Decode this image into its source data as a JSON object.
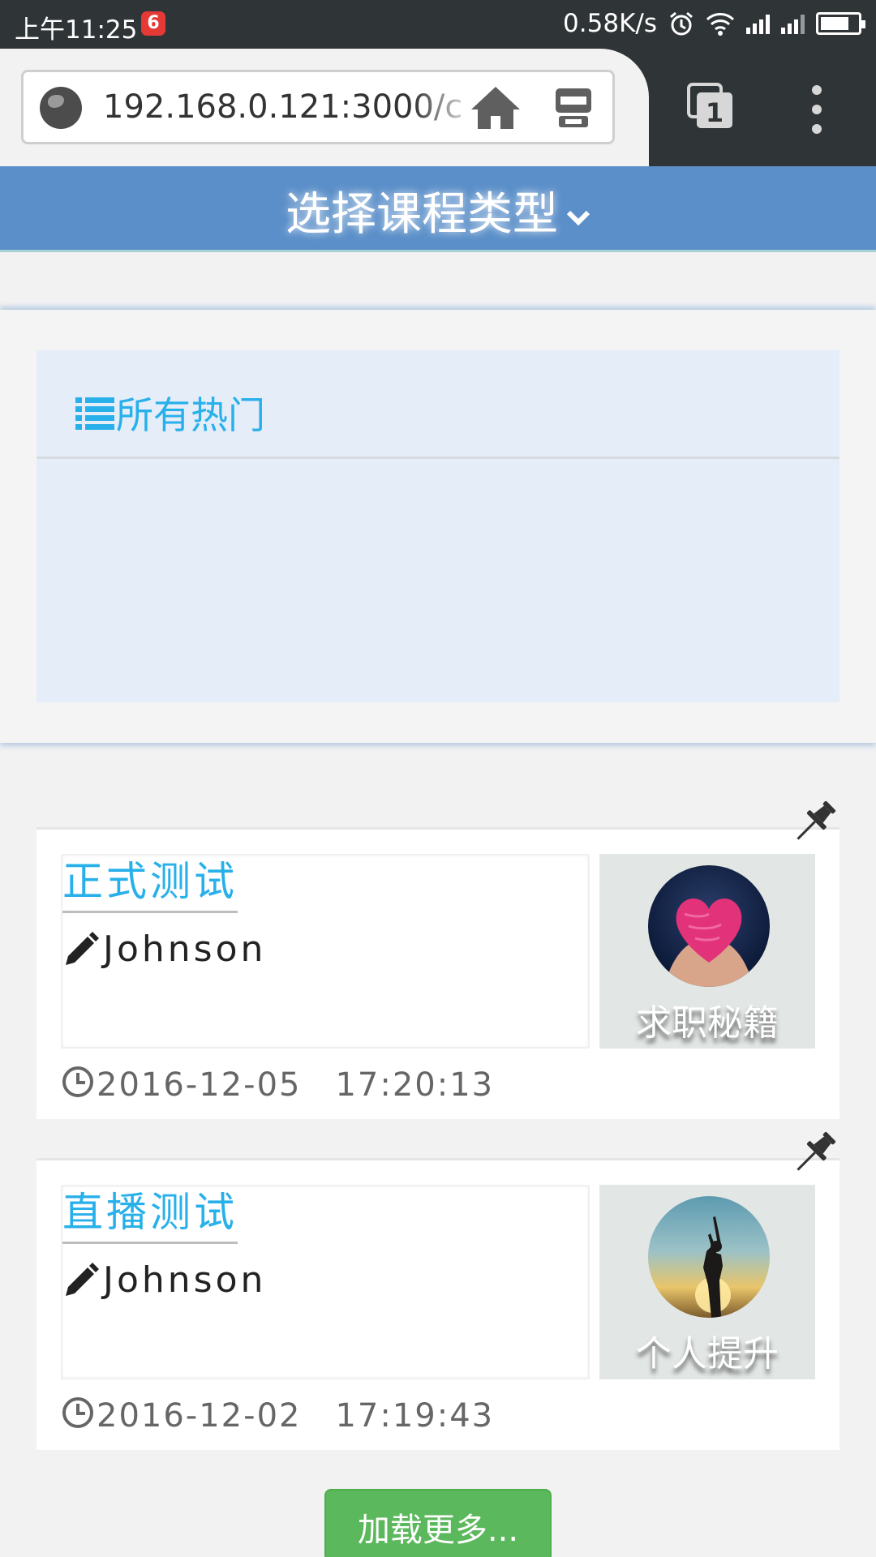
{
  "status_bar": {
    "time": "上午11:25",
    "app_badge": "6",
    "net_speed": "0.58K/s"
  },
  "browser": {
    "url": "192.168.0.121:3000/c",
    "tab_count": "1"
  },
  "header": {
    "title": "选择课程类型"
  },
  "hot_panel": {
    "title": "所有热门"
  },
  "courses": [
    {
      "title": "正式测试",
      "author": "Johnson",
      "category": "求职秘籍",
      "datetime": "2016-12-05　17:20:13",
      "thumb_icon": "heart-in-hands-image"
    },
    {
      "title": "直播测试",
      "author": "Johnson",
      "category": "个人提升",
      "datetime": "2016-12-02　17:19:43",
      "thumb_icon": "silhouette-sunset-image"
    }
  ],
  "load_more_label": "加载更多...",
  "colors": {
    "status_bar_bg": "#2f3437",
    "header_bg": "#5b8fc9",
    "accent_text": "#28b0ea",
    "load_more_bg": "#5cb85c"
  }
}
